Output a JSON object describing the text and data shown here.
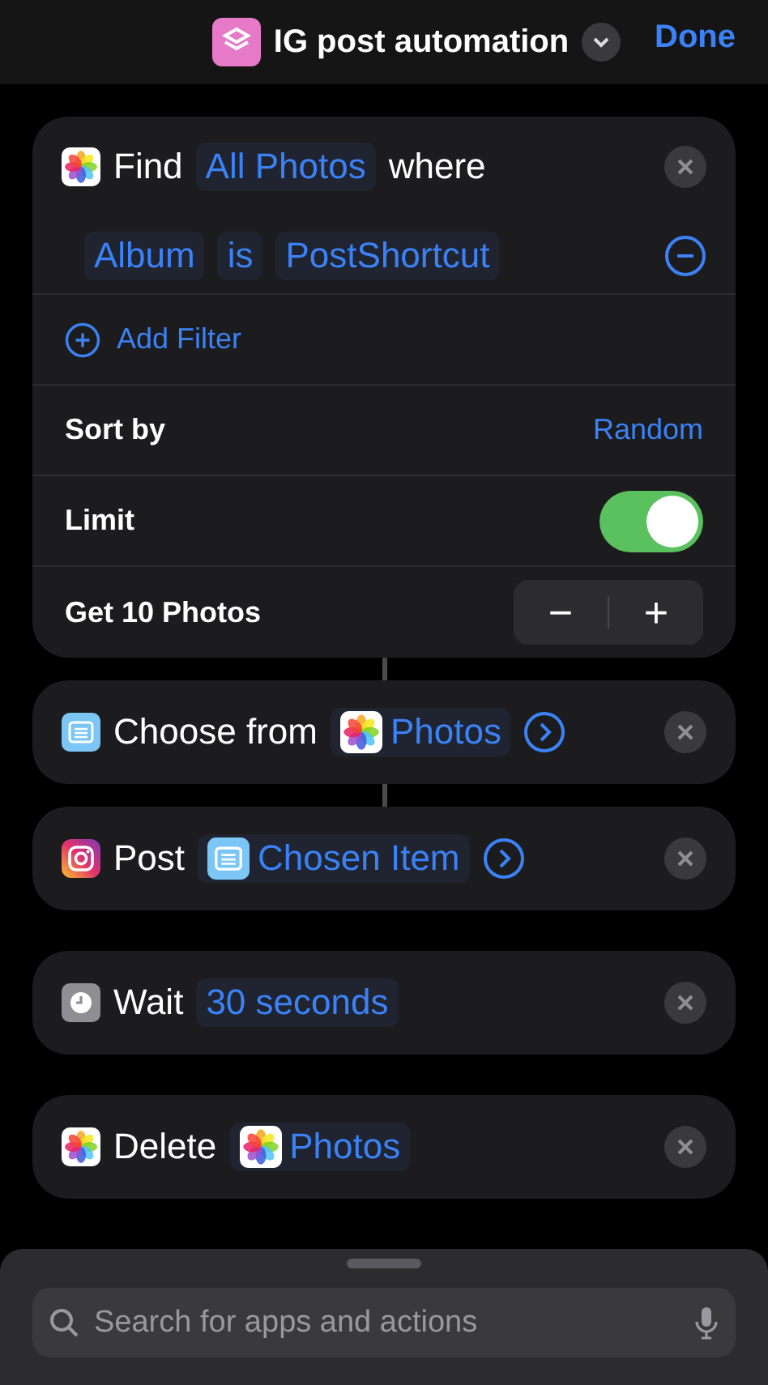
{
  "header": {
    "title": "IG post automation",
    "done": "Done"
  },
  "find_action": {
    "parts": [
      {
        "kind": "text",
        "text": "Find"
      },
      {
        "kind": "token",
        "text": "All Photos"
      },
      {
        "kind": "text",
        "text": "where"
      }
    ],
    "filters": [
      {
        "parts": [
          {
            "kind": "token",
            "text": "Album"
          },
          {
            "kind": "token",
            "text": "is"
          },
          {
            "kind": "token",
            "text": "PostShortcut"
          }
        ]
      }
    ],
    "add_filter": "Add Filter",
    "settings": [
      {
        "kind": "value",
        "label": "Sort by",
        "value": "Random"
      },
      {
        "kind": "toggle",
        "label": "Limit",
        "on": true
      },
      {
        "kind": "stepper",
        "label": "Get 10 Photos",
        "minus": "−",
        "plus": "+"
      }
    ]
  },
  "actions": [
    {
      "linked": true,
      "expand": true,
      "parts": [
        {
          "kind": "text",
          "text": "Choose from"
        },
        {
          "kind": "token",
          "text": "Photos"
        }
      ]
    },
    {
      "linked": true,
      "expand": true,
      "parts": [
        {
          "kind": "text",
          "text": "Post"
        },
        {
          "kind": "token",
          "text": "Chosen Item"
        }
      ]
    },
    {
      "linked": false,
      "expand": false,
      "parts": [
        {
          "kind": "text",
          "text": "Wait"
        },
        {
          "kind": "token",
          "text": "30 seconds"
        }
      ]
    },
    {
      "linked": false,
      "expand": false,
      "parts": [
        {
          "kind": "text",
          "text": "Delete"
        },
        {
          "kind": "token",
          "text": "Photos"
        }
      ]
    }
  ],
  "search": {
    "placeholder": "Search for apps and actions"
  }
}
